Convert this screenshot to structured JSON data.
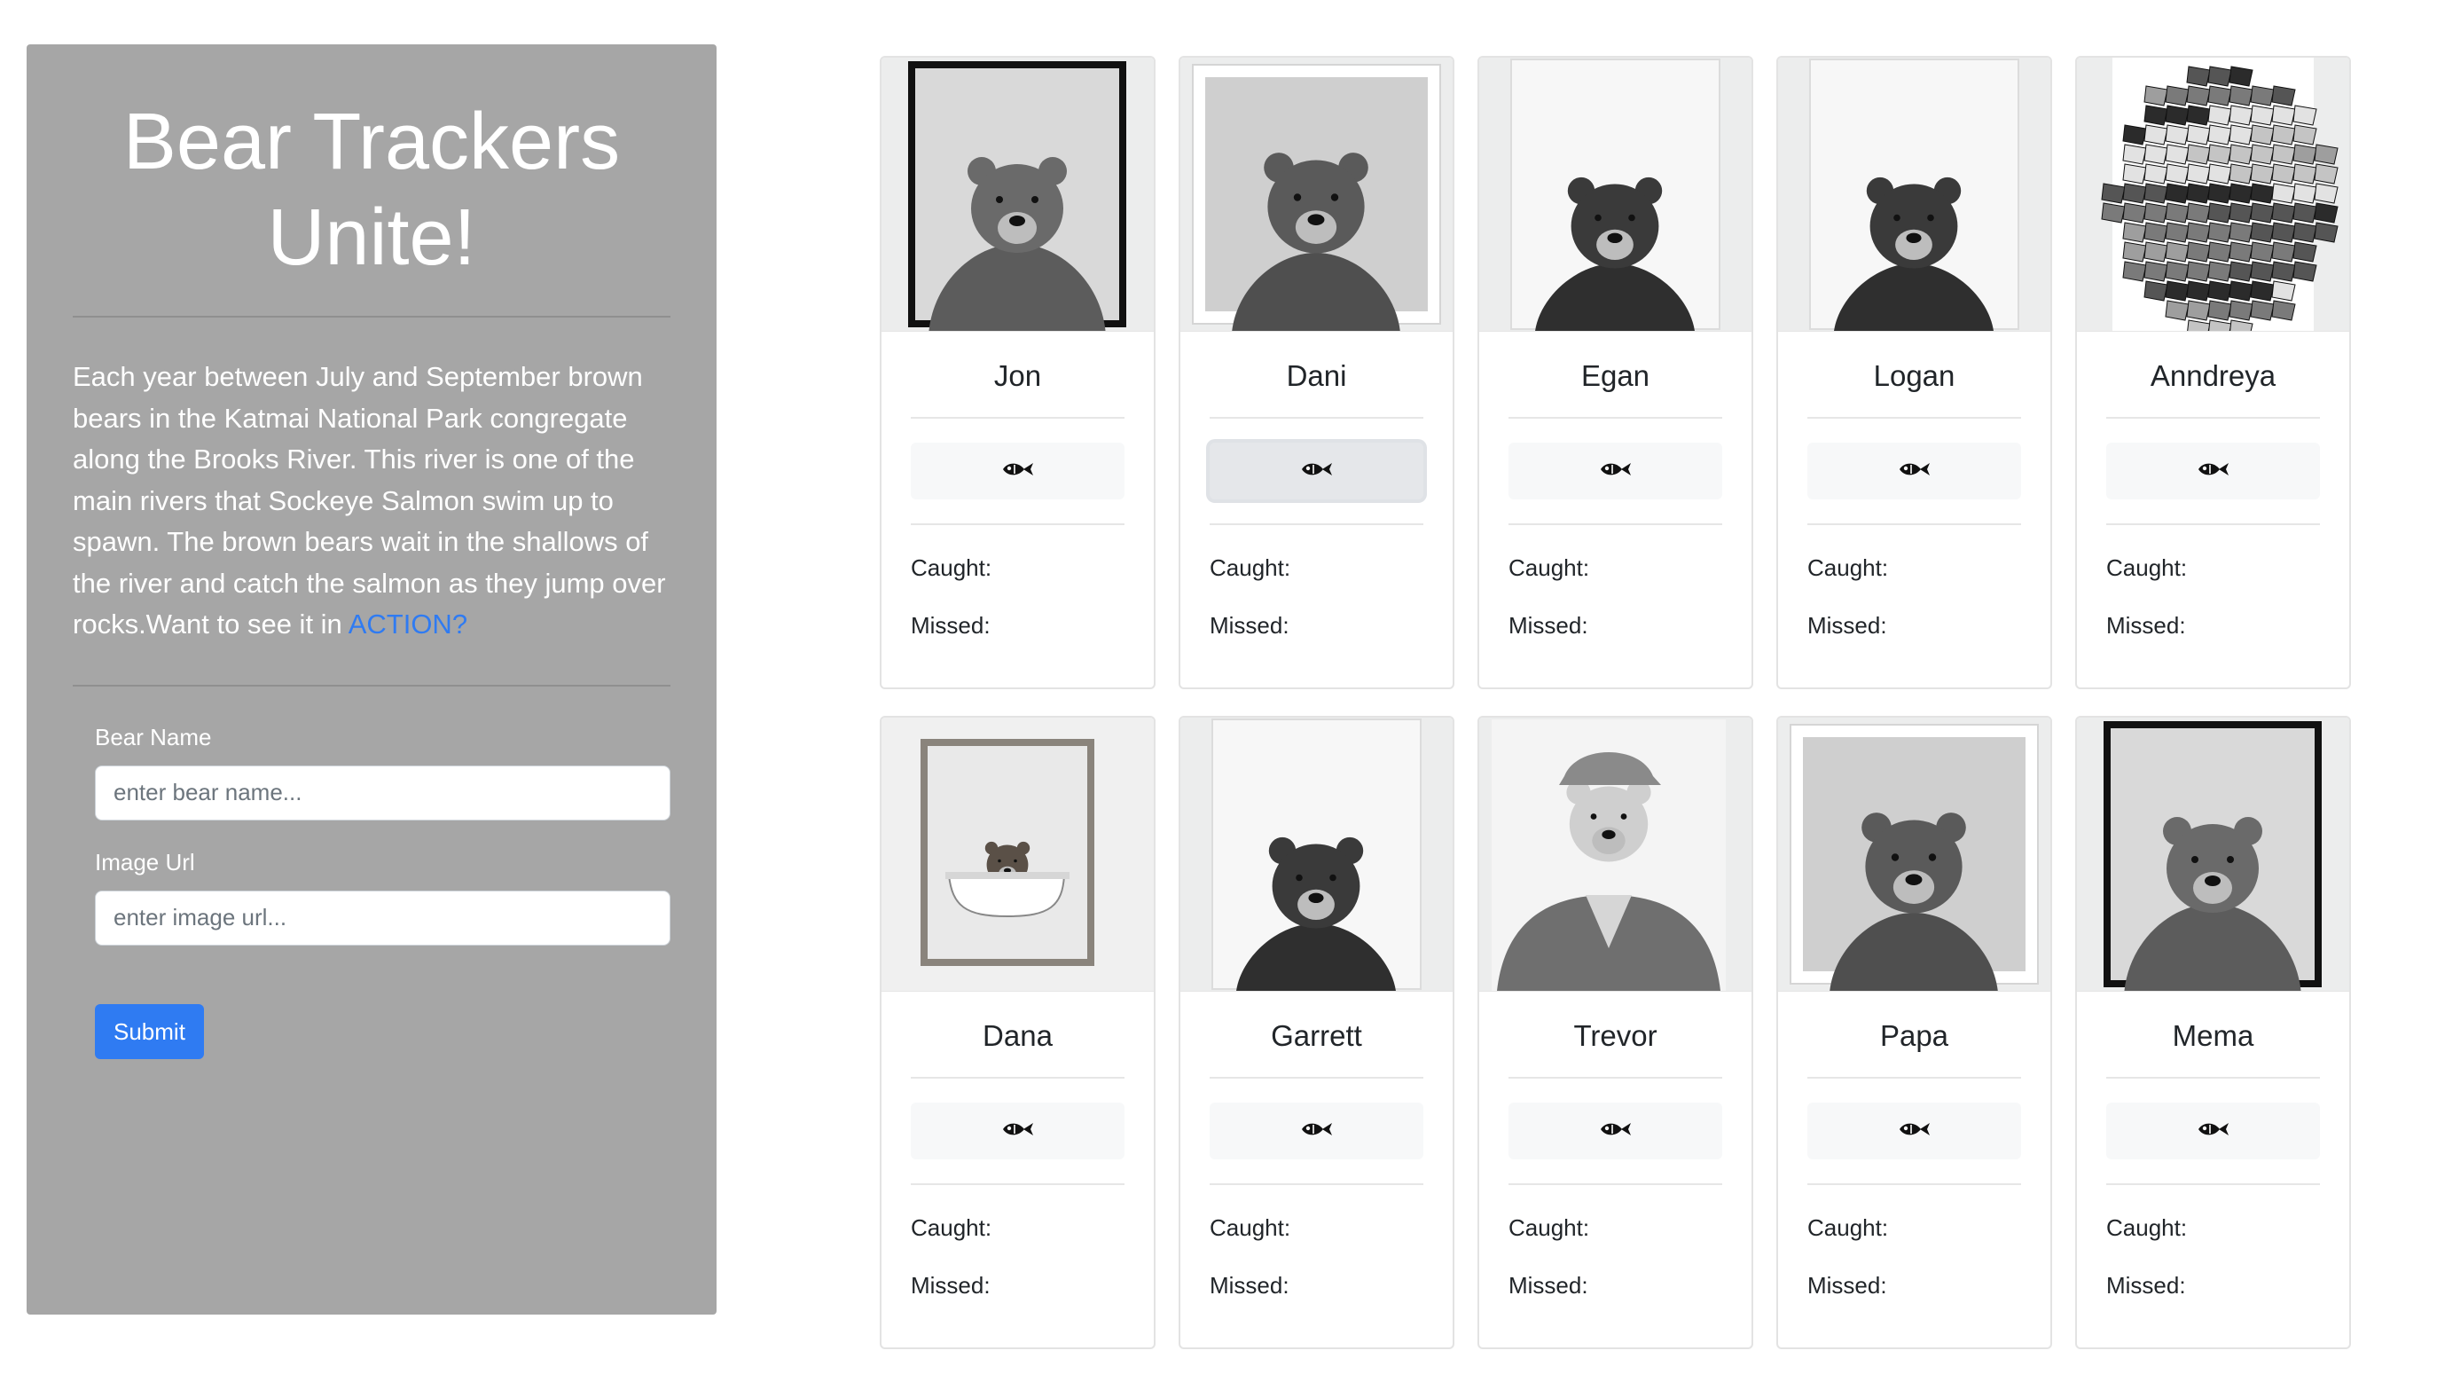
{
  "sidebar": {
    "title": "Bear Trackers Unite!",
    "intro_text": "Each year between July and September brown bears in the Katmai National Park congregate along the Brooks River. This river is one of the main rivers that Sockeye Salmon swim up to spawn. The brown bears wait in the shallows of the river and catch the salmon as they jump over rocks.Want to see it in ",
    "action_link": "ACTION?",
    "form": {
      "name_label": "Bear Name",
      "name_placeholder": "enter bear name...",
      "url_label": "Image Url",
      "url_placeholder": "enter image url...",
      "submit_label": "Submit"
    }
  },
  "labels": {
    "caught": "Caught:",
    "missed": "Missed:"
  },
  "colors": {
    "sidebar_bg": "#a6a6a6",
    "accent": "#2f7bf2"
  },
  "bears": [
    {
      "name": "Jon",
      "photo": "framed-black"
    },
    {
      "name": "Dani",
      "photo": "framed-white"
    },
    {
      "name": "Egan",
      "photo": "print"
    },
    {
      "name": "Logan",
      "photo": "print"
    },
    {
      "name": "Anndreya",
      "photo": "mosaic"
    },
    {
      "name": "Dana",
      "photo": "bathtub"
    },
    {
      "name": "Garrett",
      "photo": "print"
    },
    {
      "name": "Trevor",
      "photo": "suit"
    },
    {
      "name": "Papa",
      "photo": "framed-white"
    },
    {
      "name": "Mema",
      "photo": "framed-black"
    }
  ],
  "active_fish_button_index": 1,
  "fish_icon": "fish-icon"
}
